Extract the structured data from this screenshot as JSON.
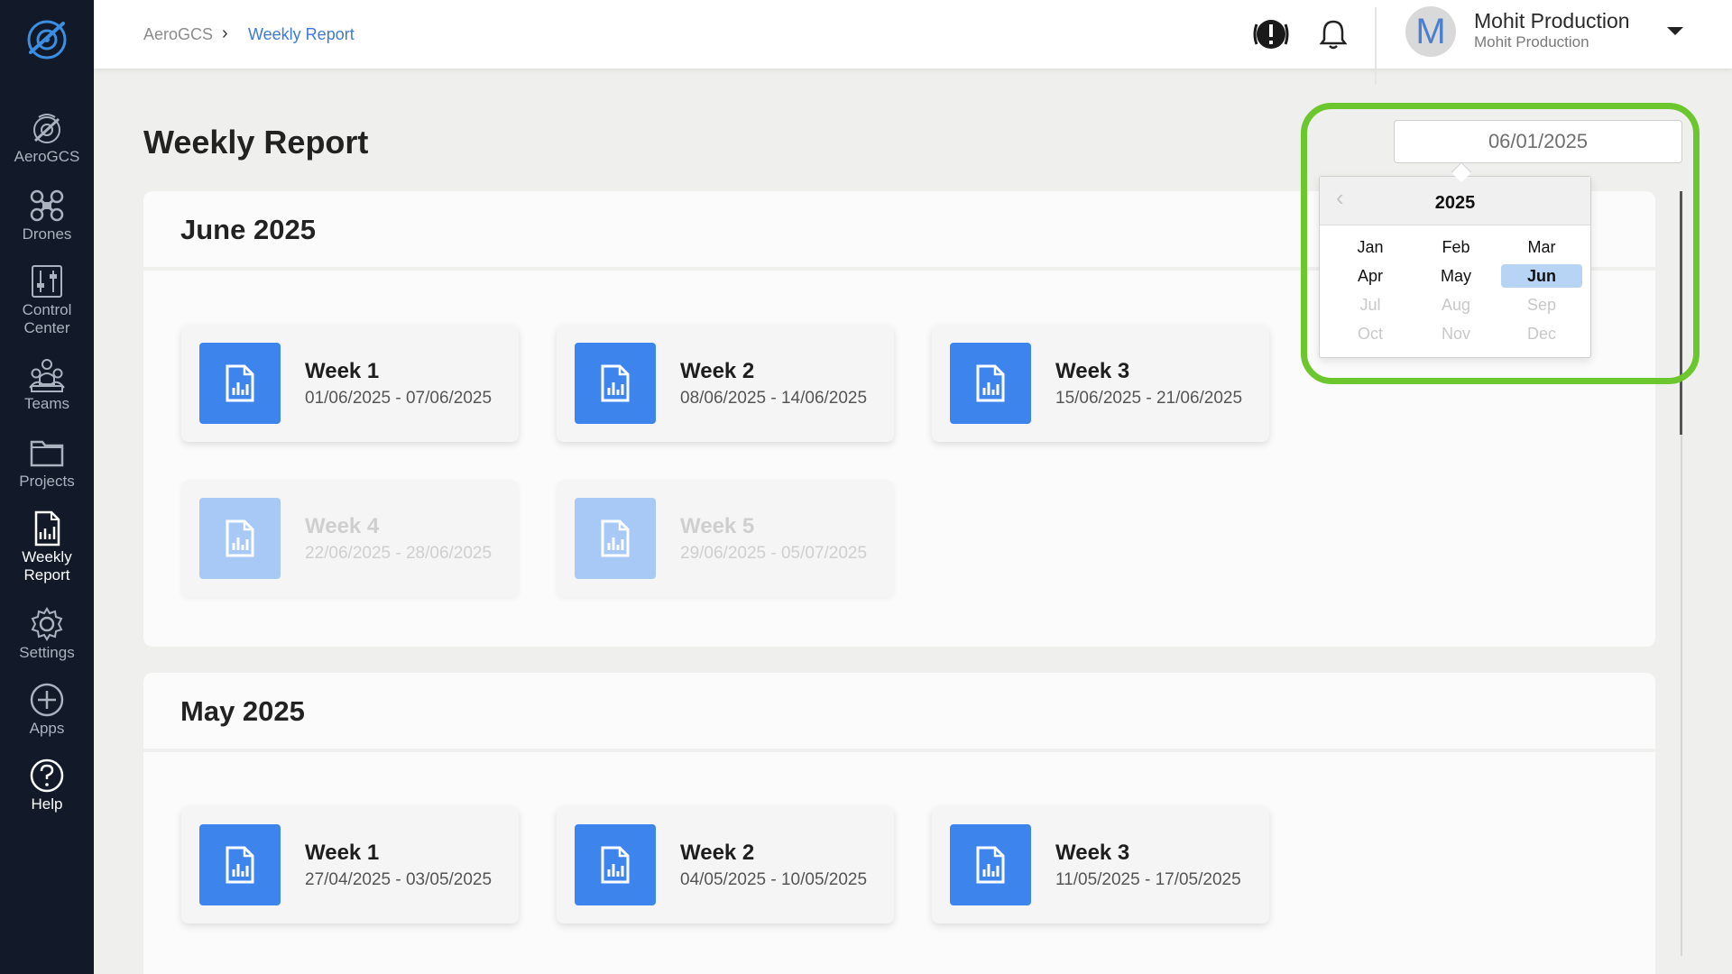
{
  "sidebar": {
    "items": [
      {
        "label": "AeroGCS",
        "icon": "aerogcs-drone-icon"
      },
      {
        "label": "Drones",
        "icon": "drone-icon"
      },
      {
        "label": "Control Center",
        "icon": "sliders-icon"
      },
      {
        "label": "Teams",
        "icon": "team-icon"
      },
      {
        "label": "Projects",
        "icon": "folder-icon"
      },
      {
        "label": "Weekly Report",
        "icon": "report-icon"
      },
      {
        "label": "Settings",
        "icon": "gear-icon"
      },
      {
        "label": "Apps",
        "icon": "plus-circle-icon"
      },
      {
        "label": "Help",
        "icon": "question-circle-icon"
      }
    ]
  },
  "header": {
    "breadcrumb_root": "AeroGCS",
    "breadcrumb_sep": "›",
    "breadcrumb_current": "Weekly Report",
    "avatar_letter": "M",
    "user_name": "Mohit Production",
    "user_org": "Mohit Production"
  },
  "page": {
    "title": "Weekly Report"
  },
  "datepicker": {
    "value": "06/01/2025",
    "year": "2025",
    "prev": "‹",
    "months": [
      "Jan",
      "Feb",
      "Mar",
      "Apr",
      "May",
      "Jun",
      "Jul",
      "Aug",
      "Sep",
      "Oct",
      "Nov",
      "Dec"
    ],
    "selected_month": "Jun"
  },
  "sections": [
    {
      "title": "June 2025",
      "weeks": [
        {
          "label": "Week 1",
          "range": "01/06/2025 - 07/06/2025",
          "enabled": true
        },
        {
          "label": "Week 2",
          "range": "08/06/2025 - 14/06/2025",
          "enabled": true
        },
        {
          "label": "Week 3",
          "range": "15/06/2025 - 21/06/2025",
          "enabled": true
        },
        {
          "label": "Week 4",
          "range": "22/06/2025 - 28/06/2025",
          "enabled": false
        },
        {
          "label": "Week 5",
          "range": "29/06/2025 - 05/07/2025",
          "enabled": false
        }
      ]
    },
    {
      "title": "May 2025",
      "weeks": [
        {
          "label": "Week 1",
          "range": "27/04/2025 - 03/05/2025",
          "enabled": true
        },
        {
          "label": "Week 2",
          "range": "04/05/2025 - 10/05/2025",
          "enabled": true
        },
        {
          "label": "Week 3",
          "range": "11/05/2025 - 17/05/2025",
          "enabled": true
        }
      ]
    }
  ],
  "colors": {
    "sidebar_bg": "#121a29",
    "accent_blue": "#3d84ec",
    "highlight_green": "#6cc72e",
    "selected_month_bg": "#b7d4f5"
  }
}
